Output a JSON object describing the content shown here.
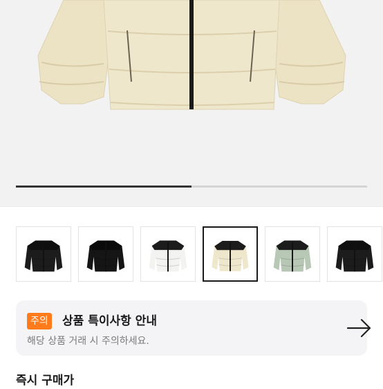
{
  "gallery": {
    "progress": 0.5,
    "selected_index": 3,
    "thumbnails": [
      {
        "color": "black",
        "body": "#1c1c1c",
        "trim": "#0f0f0f"
      },
      {
        "color": "glossy black",
        "body": "#151515",
        "trim": "#0a0a0a"
      },
      {
        "color": "white",
        "body": "#f3f3f1",
        "trim": "#1c1c1c"
      },
      {
        "color": "cream",
        "body": "#efe7cc",
        "trim": "#1c1c1c"
      },
      {
        "color": "sage green",
        "body": "#b7c8b5",
        "trim": "#1c1c1c"
      },
      {
        "color": "black",
        "body": "#1c1c1c",
        "trim": "#0f0f0f"
      }
    ]
  },
  "notice": {
    "badge": "주의",
    "title": "상품 특이사항 안내",
    "description": "해당 상품 거래 시 주의하세요.",
    "arrow_icon": "arrow-right-icon"
  },
  "next_section": {
    "title": "즉시 구매가"
  },
  "colors": {
    "accent": "#ff7a1a",
    "hero_background": "#f2f2f2",
    "jacket_cream": "#efe7cc"
  }
}
